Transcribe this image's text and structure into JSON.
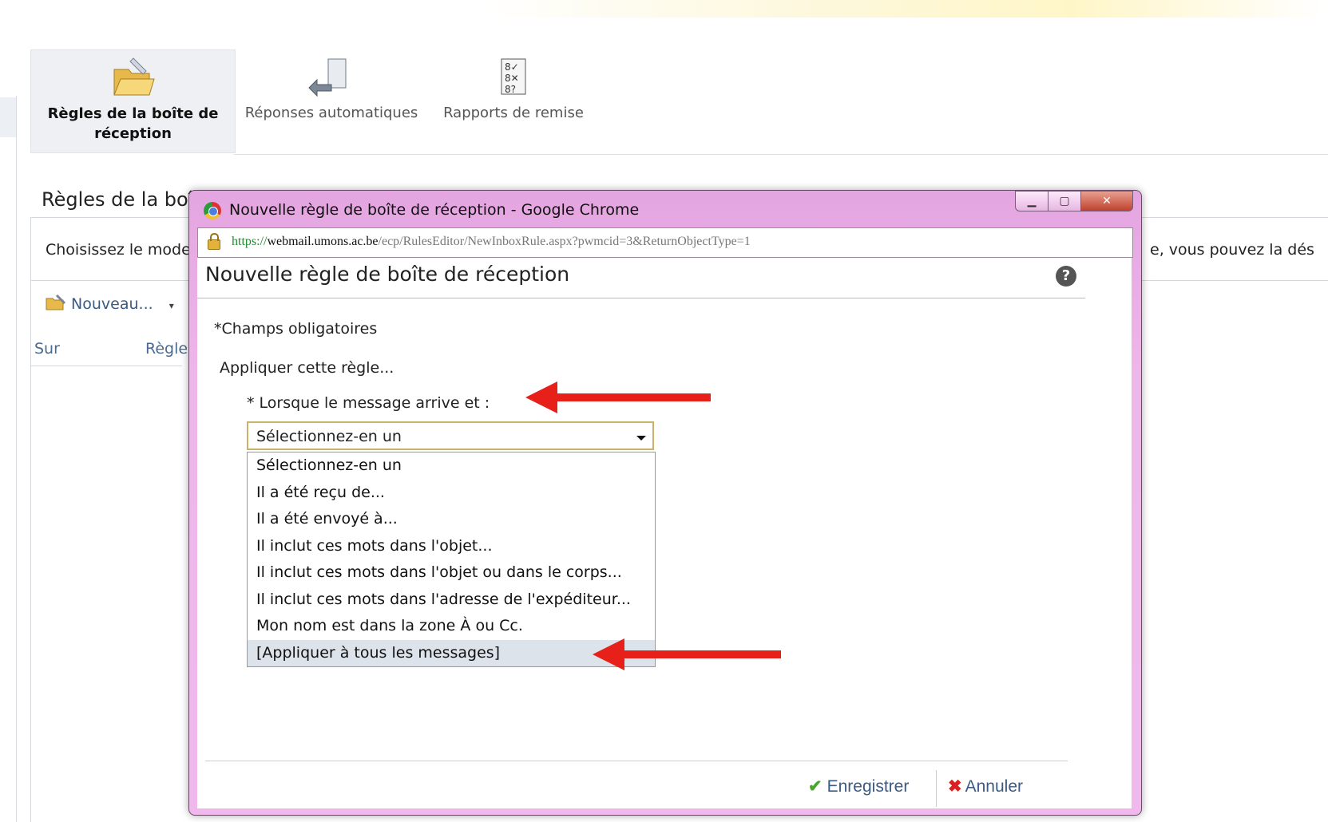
{
  "ribbon": {
    "inbox_rules_line1": "Règles de la boîte de",
    "inbox_rules_line2": "réception",
    "auto_replies": "Réponses automatiques",
    "delivery_reports": "Rapports de remise"
  },
  "page": {
    "title": "Règles de la boî",
    "description": "Choisissez le mode",
    "description_tail": "e, vous pouvez la dés",
    "new_button": "Nouveau...",
    "col_on": "Sur",
    "col_rule": "Règle"
  },
  "window": {
    "title": "Nouvelle règle de boîte de réception - Google Chrome",
    "url_scheme": "https://",
    "url_host": "webmail.umons.ac.be",
    "url_path": "/ecp/RulesEditor/NewInboxRule.aspx?pwmcid=3&ReturnObjectType=1"
  },
  "dialog": {
    "title": "Nouvelle règle de boîte de réception",
    "required_note": "*Champs obligatoires",
    "apply_rule": "Appliquer cette règle...",
    "when_label": "* Lorsque le message arrive et :",
    "select_value": "Sélectionnez-en un",
    "options": [
      "Sélectionnez-en un",
      "Il a été reçu de...",
      "Il a été envoyé à...",
      "Il inclut ces mots dans l'objet...",
      "Il inclut ces mots dans l'objet ou dans le corps...",
      "Il inclut ces mots dans l'adresse de l'expéditeur...",
      "Mon nom est dans la zone À ou Cc.",
      "[Appliquer à tous les messages]"
    ],
    "save_label": "Enregistrer",
    "cancel_label": "Annuler",
    "help_glyph": "?"
  },
  "colors": {
    "window_frame": "#efb6ea",
    "annotation_arrow": "#e8201a",
    "option_highlight": "#dde3ea"
  }
}
